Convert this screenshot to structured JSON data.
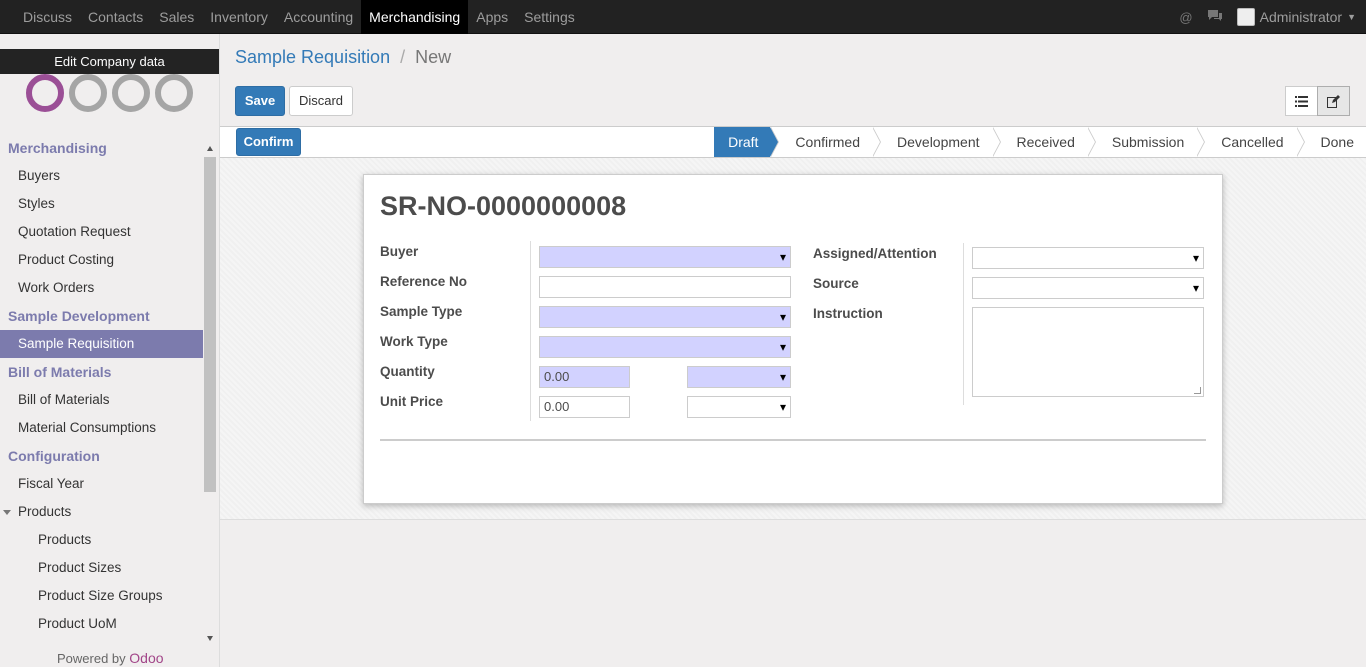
{
  "topbar": {
    "menu": [
      "Discuss",
      "Contacts",
      "Sales",
      "Inventory",
      "Accounting",
      "Merchandising",
      "Apps",
      "Settings"
    ],
    "active": "Merchandising",
    "user": "Administrator"
  },
  "sidebar": {
    "company_button": "Edit Company data",
    "sections": [
      {
        "title": "Merchandising",
        "items": [
          "Buyers",
          "Styles",
          "Quotation Request",
          "Product Costing",
          "Work Orders"
        ]
      },
      {
        "title": "Sample Development",
        "items": [
          "Sample Requisition"
        ]
      },
      {
        "title": "Bill of Materials",
        "items": [
          "Bill of Materials",
          "Material Consumptions"
        ]
      },
      {
        "title": "Configuration",
        "items": [
          "Fiscal Year",
          "Products"
        ]
      }
    ],
    "products_sub": [
      "Products",
      "Product Sizes",
      "Product Size Groups",
      "Product UoM"
    ],
    "powered_prefix": "Powered by",
    "powered_brand": "Odoo"
  },
  "breadcrumb": {
    "parent": "Sample Requisition",
    "sep": "/",
    "current": "New"
  },
  "buttons": {
    "save": "Save",
    "discard": "Discard",
    "confirm": "Confirm"
  },
  "stages": [
    "Draft",
    "Confirmed",
    "Development",
    "Received",
    "Submission",
    "Cancelled",
    "Done"
  ],
  "form": {
    "title": "SR-NO-0000000008",
    "labels": {
      "buyer": "Buyer",
      "reference_no": "Reference No",
      "sample_type": "Sample Type",
      "work_type": "Work Type",
      "quantity": "Quantity",
      "unit_price": "Unit Price",
      "assigned": "Assigned/Attention",
      "source": "Source",
      "instruction": "Instruction"
    },
    "values": {
      "quantity": "0.00",
      "unit_price": "0.00"
    }
  },
  "colors": {
    "accent": "#337ab7",
    "menu_header": "#7c7bad",
    "required_field": "#d2d2ff"
  }
}
